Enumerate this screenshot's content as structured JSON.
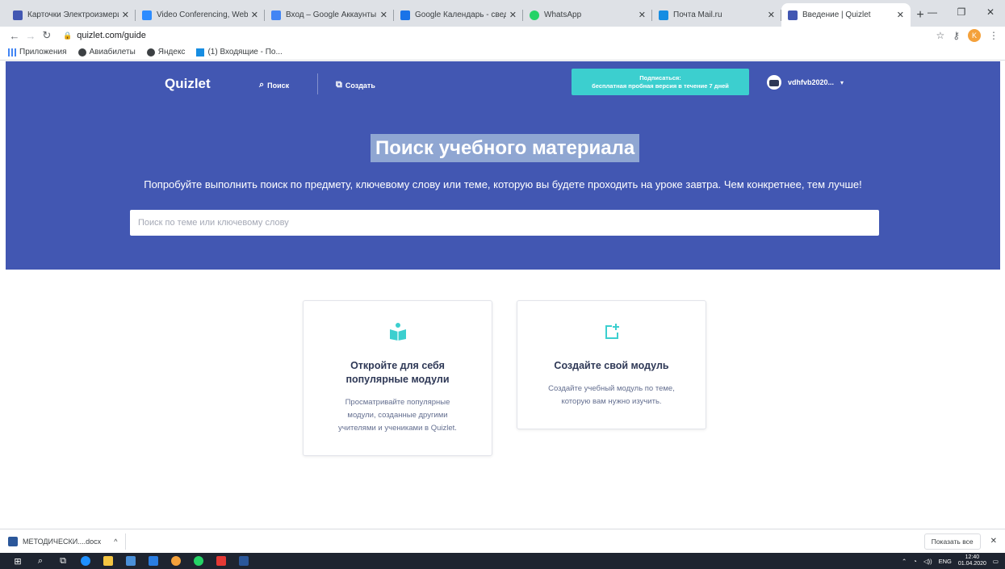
{
  "browser": {
    "tabs": [
      {
        "title": "Карточки Электроизмерительн",
        "color": "#4257b2"
      },
      {
        "title": "Video Conferencing, Web Confe",
        "color": "#2d8cff"
      },
      {
        "title": "Вход – Google Аккаунты",
        "color": "#4285f4"
      },
      {
        "title": "Google Календарь - сведения о",
        "color": "#1a73e8"
      },
      {
        "title": "WhatsApp",
        "color": "#25d366"
      },
      {
        "title": "Почта Mail.ru",
        "color": "#168de2"
      },
      {
        "title": "Введение | Quizlet",
        "color": "#4257b2",
        "active": true
      }
    ],
    "url": "quizlet.com/guide",
    "profile_initial": "K",
    "bookmarks": [
      {
        "label": "Приложения",
        "color": "#4285f4"
      },
      {
        "label": "Авиабилеты",
        "color": "#3c4043"
      },
      {
        "label": "Яндекс",
        "color": "#3c4043"
      },
      {
        "label": "(1) Входящие - По...",
        "color": "#168de2"
      }
    ]
  },
  "header": {
    "logo": "Quizlet",
    "search_link": "Поиск",
    "create_link": "Создать",
    "subscribe_line1": "Подписаться:",
    "subscribe_line2": "бесплатная пробная версия в течение 7 дней",
    "username": "vdhfvb2020..."
  },
  "hero": {
    "title": "Поиск учебного материала",
    "subtitle": "Попробуйте выполнить поиск по предмету, ключевому слову или теме, которую вы будете проходить на уроке завтра. Чем конкретнее, тем лучше!",
    "search_placeholder": "Поиск по теме или ключевому слову"
  },
  "cards": [
    {
      "title": "Откройте для себя популярные модули",
      "description": "Просматривайте популярные модули, созданные другими учителями и учениками в Quizlet.",
      "icon": "book-reader-icon"
    },
    {
      "title": "Создайте свой модуль",
      "description": "Создайте учебный модуль по теме, которую вам нужно изучить.",
      "icon": "create-module-icon"
    }
  ],
  "downloads": {
    "file": "МЕТОДИЧЕСКИ....docx",
    "show_all": "Показать все"
  },
  "taskbar": {
    "lang": "ENG",
    "time": "12:40",
    "date": "01.04.2020"
  },
  "colors": {
    "brand": "#4257b2",
    "accent": "#3ccfcf",
    "title_highlight": "#8fa6d2"
  }
}
